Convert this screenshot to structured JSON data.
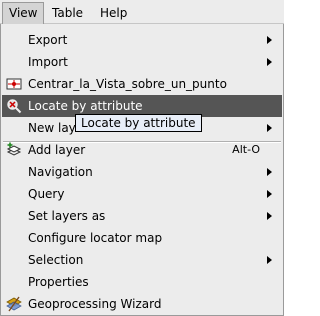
{
  "menubar": {
    "items": [
      {
        "label": "View"
      },
      {
        "label": "Table"
      },
      {
        "label": "Help"
      }
    ]
  },
  "menu": {
    "items": [
      {
        "label": "Export"
      },
      {
        "label": "Import"
      },
      {
        "label": "Centrar_la_Vista_sobre_un_punto",
        "icon": "center-view-on-point-icon"
      },
      {
        "label": "Locate by attribute",
        "icon": "locate-by-attribute-icon"
      },
      {
        "label": "New layer"
      },
      {
        "label": "Add layer",
        "icon": "add-layer-icon",
        "accelerator": "Alt-O"
      },
      {
        "label": "Navigation"
      },
      {
        "label": "Query"
      },
      {
        "label": "Set layers as"
      },
      {
        "label": "Configure locator map"
      },
      {
        "label": "Selection"
      },
      {
        "label": "Properties"
      },
      {
        "label": "Geoprocessing Wizard",
        "icon": "geoprocessing-wizard-icon"
      }
    ]
  },
  "tooltip": {
    "text": "Locate by attribute"
  },
  "colors": {
    "menu_background": "#ececec",
    "highlight_background": "#555555",
    "highlight_text": "#ffffff",
    "tooltip_background": "#e8eef8"
  }
}
